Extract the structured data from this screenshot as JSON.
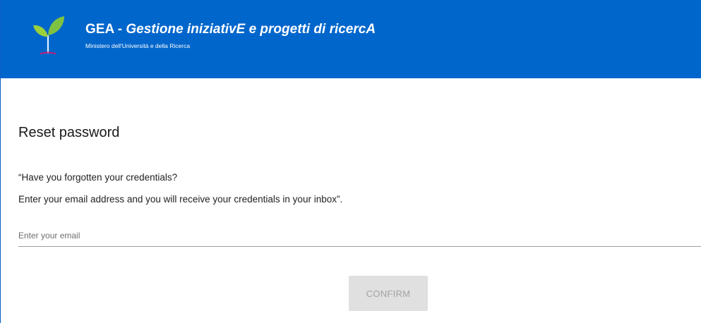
{
  "header": {
    "brand_prefix": "GEA - ",
    "brand_italic": "Gestione iniziativE e progetti di ricercA",
    "subtitle": "Ministero dell'Università e della Ricerca",
    "logo_icon": "sprout-icon",
    "background_color": "#0066cc"
  },
  "main": {
    "title": "Reset password",
    "intro_line_1": "“Have you forgotten your credentials?",
    "intro_line_2": "Enter your email address and you will receive your credentials in your inbox”.",
    "email": {
      "value": "",
      "placeholder": "Enter your email"
    },
    "confirm_label": "CONFIRM",
    "confirm_state": "disabled"
  }
}
